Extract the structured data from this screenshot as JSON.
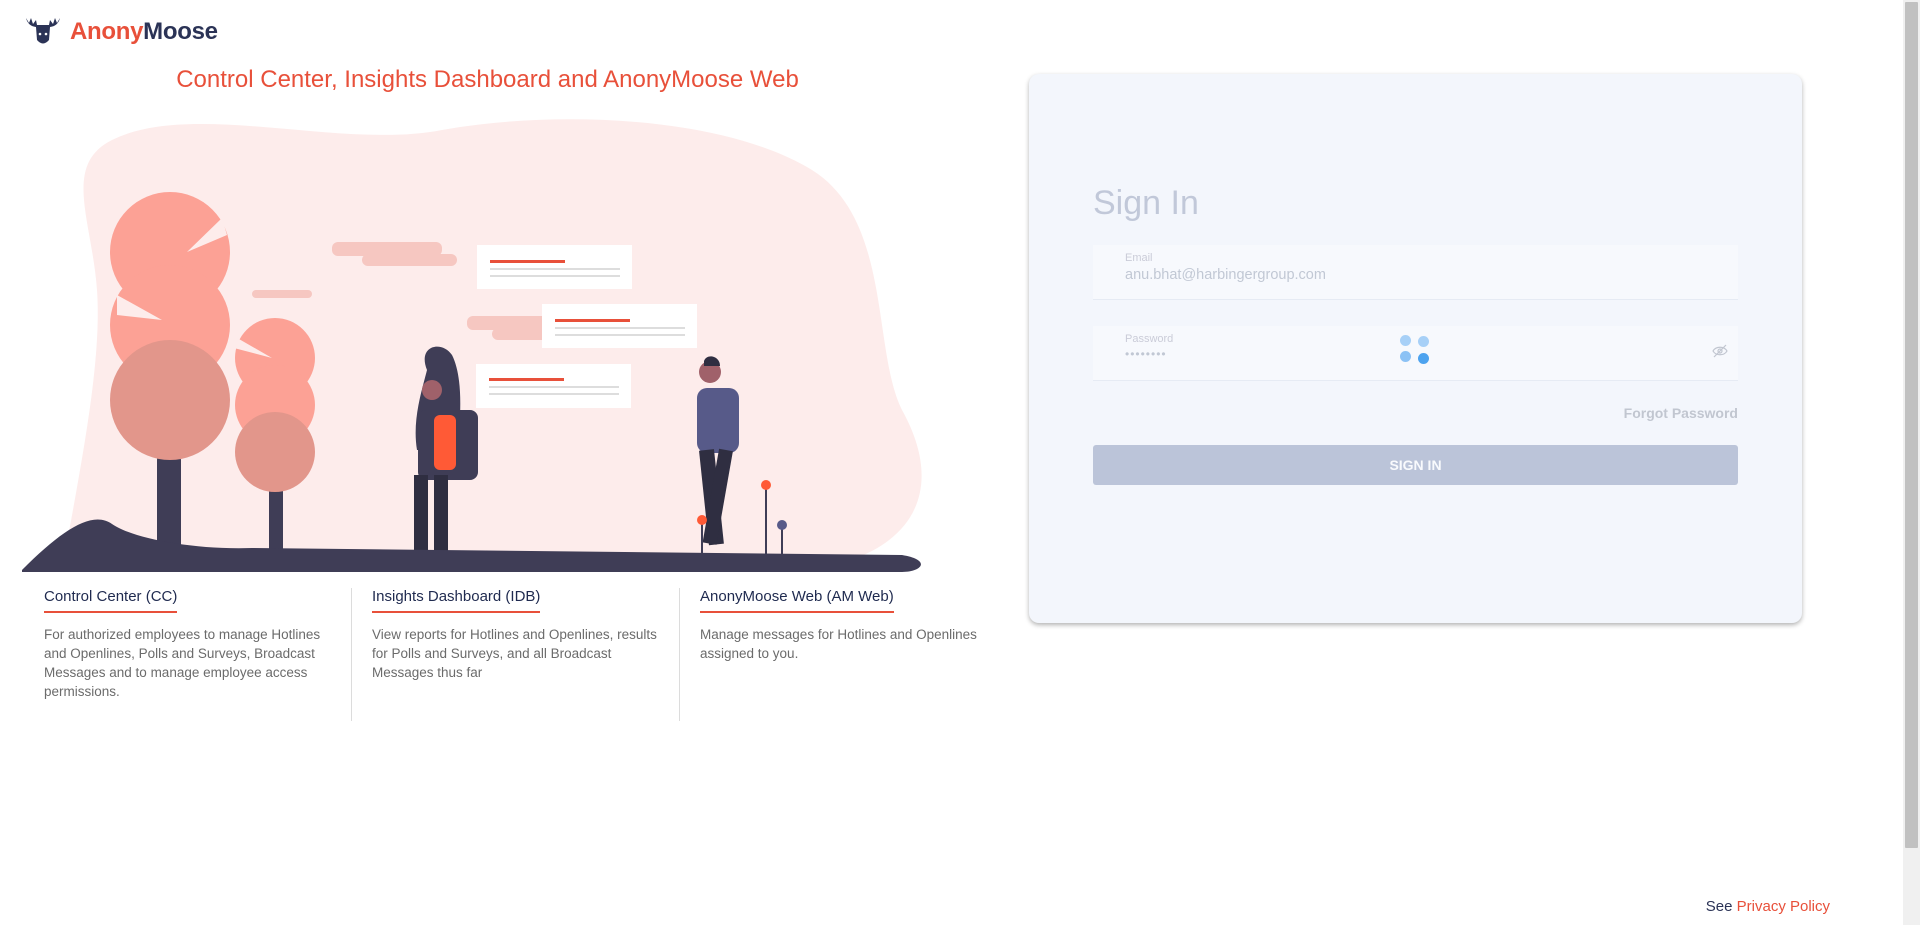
{
  "brand": {
    "name_part1": "Anony",
    "name_part2": "Moose"
  },
  "headline": "Control Center, Insights Dashboard and AnonyMoose Web",
  "features": [
    {
      "title": "Control Center (CC)",
      "description": "For authorized employees to manage Hotlines and Openlines, Polls and Surveys, Broadcast Messages and to manage employee access permissions."
    },
    {
      "title": "Insights Dashboard (IDB)",
      "description": "View reports for Hotlines and Openlines, results for Polls and Surveys, and all Broadcast Messages thus far"
    },
    {
      "title": "AnonyMoose Web (AM Web)",
      "description": "Manage messages for Hotlines and Openlines assigned to you."
    }
  ],
  "signin": {
    "title": "Sign In",
    "email_label": "Email",
    "email_value": "anu.bhat@harbingergroup.com",
    "password_label": "Password",
    "password_value": "••••••••",
    "forgot_label": "Forgot Password",
    "submit_label": "SIGN IN"
  },
  "footer": {
    "prefix": "See",
    "link": "Privacy Policy"
  },
  "colors": {
    "accent": "#e8503a",
    "navy": "#2b3356",
    "card_bg": "#f3f6fc",
    "button": "#8e9dbd",
    "spinner": "#4da3ef"
  },
  "icons": [
    "moose-logo-icon",
    "eye-slash-icon",
    "loading-spinner-icon"
  ]
}
